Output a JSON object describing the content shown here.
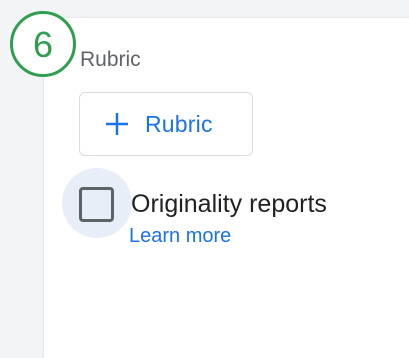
{
  "step": {
    "number": "6",
    "color": "#2f9e4f"
  },
  "rubric": {
    "section_title": "Rubric",
    "add_button_label": "Rubric",
    "add_button_icon": "plus-icon"
  },
  "originality": {
    "checkbox_label": "Originality reports",
    "checked": false,
    "learn_more_label": "Learn more"
  },
  "colors": {
    "accent": "#1a73e8",
    "text": "#202124",
    "muted": "#5f6368",
    "background": "#f3f4f6"
  }
}
